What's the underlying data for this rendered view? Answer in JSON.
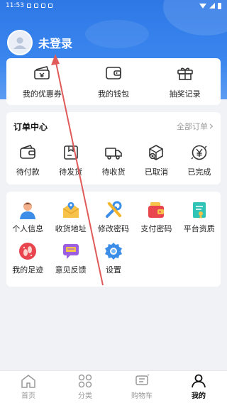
{
  "statusbar": {
    "time": "11:53"
  },
  "profile": {
    "name": "未登录"
  },
  "quick": [
    {
      "label": "我的优惠券",
      "icon": "coupon-icon"
    },
    {
      "label": "我的钱包",
      "icon": "wallet-icon"
    },
    {
      "label": "抽奖记录",
      "icon": "gift-icon"
    }
  ],
  "orders": {
    "title": "订单中心",
    "all": "全部订单",
    "items": [
      {
        "label": "待付款",
        "icon": "wallet-pay-icon"
      },
      {
        "label": "待发货",
        "icon": "package-icon"
      },
      {
        "label": "待收货",
        "icon": "truck-icon"
      },
      {
        "label": "已取消",
        "icon": "cancelled-box-icon"
      },
      {
        "label": "已完成",
        "icon": "yuan-icon"
      }
    ]
  },
  "tools": [
    {
      "label": "个人信息",
      "icon": "person-icon"
    },
    {
      "label": "收货地址",
      "icon": "address-icon"
    },
    {
      "label": "修改密码",
      "icon": "tools-icon"
    },
    {
      "label": "支付密码",
      "icon": "payment-wallet-icon"
    },
    {
      "label": "平台资质",
      "icon": "certificate-icon"
    },
    {
      "label": "我的足迹",
      "icon": "footprint-icon"
    },
    {
      "label": "意见反馈",
      "icon": "feedback-icon"
    },
    {
      "label": "设置",
      "icon": "settings-icon"
    }
  ],
  "tabbar": [
    {
      "label": "首页",
      "icon": "home-icon"
    },
    {
      "label": "分类",
      "icon": "category-icon"
    },
    {
      "label": "购物车",
      "icon": "cart-icon"
    },
    {
      "label": "我的",
      "icon": "profile-icon",
      "active": true
    }
  ],
  "colors": {
    "header": "#2e78e6",
    "accent": "#3a86ee",
    "annotation": "#e05a5a"
  }
}
